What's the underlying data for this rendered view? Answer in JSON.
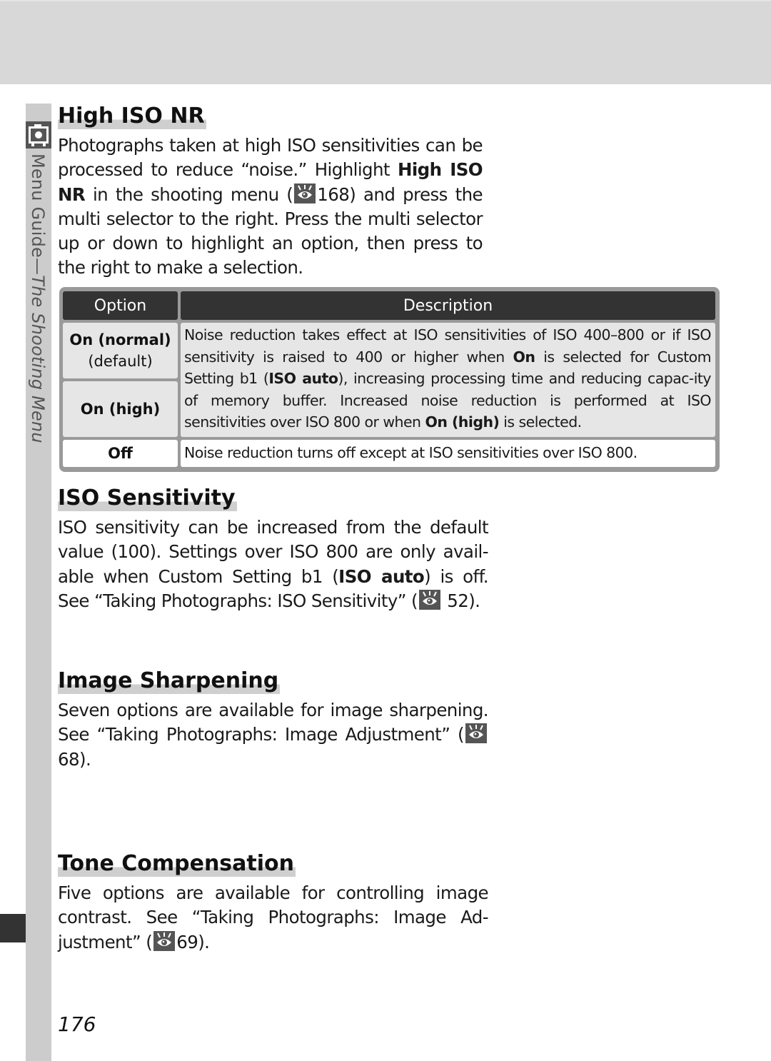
{
  "section_tab": {
    "label_part1": "Menu Guide",
    "label_dash": "—",
    "label_part2": "The Shooting Menu",
    "icon": "camera-icon"
  },
  "sections": {
    "high_iso_nr": {
      "title": "High ISO NR",
      "para": {
        "t1": "Photographs taken at high ISO sensitivities can be processed to reduce “noise.”  Highlight ",
        "b1": "High ISO NR",
        "t2": " in the shooting menu (",
        "ref": "168",
        "t3": ") and press the multi selector to the right.  Press the multi selector up or down to highlight an option, then press to the right to make a selection."
      },
      "table": {
        "headers": [
          "Option",
          "Description"
        ],
        "rows": [
          {
            "option": "On (normal)",
            "sub": "(default)"
          },
          {
            "option": "On (high)"
          },
          {
            "option": "Off"
          }
        ],
        "desc_merged": {
          "t1": "Noise reduction takes effect at ISO sensitivities of ISO 400–800 or if ISO sensitivity is raised to 400 or higher when ",
          "b1": "On",
          "t2": " is selected for Custom Setting b1 (",
          "b2": "ISO auto",
          "t3": "), increasing processing time and reducing capac-ity of memory buffer.  Increased noise reduction is performed at ISO sensitivities over ISO 800 or when ",
          "b3": "On (high)",
          "t4": " is selected."
        },
        "desc_off": "Noise reduction turns off except at ISO sensitivities over ISO 800."
      }
    },
    "iso_sensitivity": {
      "title": "ISO Sensitivity",
      "para": {
        "t1": "ISO sensitivity can be increased from the default value (100).  Settings over ISO 800 are only avail-able when Custom Setting b1 (",
        "b1": "ISO auto",
        "t2": ") is off.  See “Taking Photographs: ISO Sensitivity” (",
        "ref": "52",
        "t3": ")."
      }
    },
    "image_sharpening": {
      "title": "Image Sharpening",
      "para": {
        "t1": "Seven options are available for image sharpening. See “Taking Photographs: Image Adjustment” (",
        "ref": "68",
        "t2": ")."
      }
    },
    "tone_compensation": {
      "title": "Tone Compensation",
      "para": {
        "t1": "Five options are available for controlling image contrast.  See “Taking Photographs: Image Ad-justment” (",
        "ref": "69",
        "t2": ")."
      }
    }
  },
  "page_number": "176",
  "colors": {
    "header_bg": "#333333",
    "heading_highlight": "#cfcfcf",
    "side_strip": "#cccccc"
  }
}
